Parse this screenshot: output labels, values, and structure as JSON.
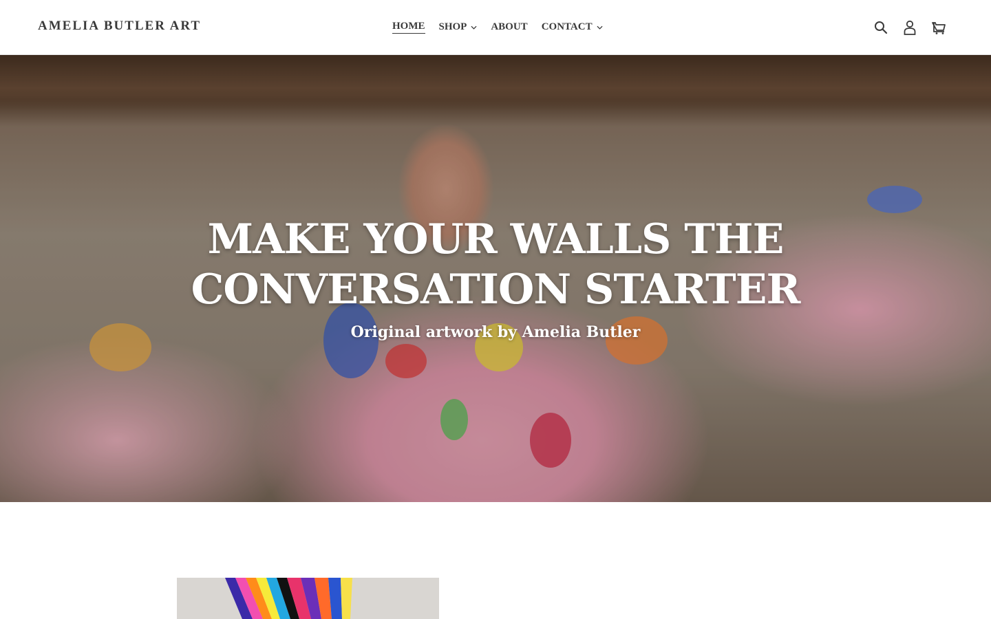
{
  "brand": {
    "name": "AMELIA BUTLER ART"
  },
  "nav": {
    "items": [
      {
        "label": "HOME",
        "active": true,
        "has_dropdown": false
      },
      {
        "label": "SHOP",
        "active": false,
        "has_dropdown": true
      },
      {
        "label": "ABOUT",
        "active": false,
        "has_dropdown": false
      },
      {
        "label": "CONTACT",
        "active": false,
        "has_dropdown": true
      }
    ]
  },
  "header_icons": [
    "search-icon",
    "account-icon",
    "cart-icon"
  ],
  "hero": {
    "title_line1": "MAKE YOUR WALLS THE",
    "title_line2": "CONVERSATION STARTER",
    "subtitle": "Original artwork by Amelia Butler"
  },
  "colors": {
    "text": "#3a3a3a",
    "hero_text": "#ffffff",
    "background": "#ffffff"
  }
}
